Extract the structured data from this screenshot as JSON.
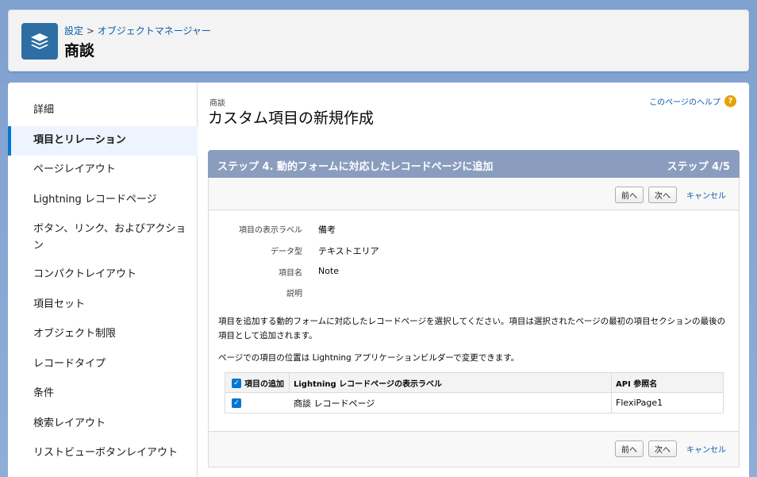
{
  "header": {
    "breadcrumb_setup": "設定",
    "breadcrumb_sep": ">",
    "breadcrumb_object_manager": "オブジェクトマネージャー",
    "title": "商談",
    "icon": "layers-icon"
  },
  "sidebar": {
    "items": [
      {
        "label": "詳細"
      },
      {
        "label": "項目とリレーション"
      },
      {
        "label": "ページレイアウト"
      },
      {
        "label": "Lightning レコードページ"
      },
      {
        "label": "ボタン、リンク、およびアクショ"
      },
      {
        "label": "ン"
      },
      {
        "label": "コンパクトレイアウト"
      },
      {
        "label": "項目セット"
      },
      {
        "label": "オブジェクト制限"
      },
      {
        "label": "レコードタイプ"
      },
      {
        "label": "条件"
      },
      {
        "label": "検索レイアウト"
      },
      {
        "label": "リストビューボタンレイアウト"
      }
    ]
  },
  "content": {
    "sup": "商談",
    "title": "カスタム項目の新規作成",
    "help_label": "このページのヘルプ",
    "help_glyph": "?",
    "step_title": "ステップ 4. 動的フォームに対応したレコードページに追加",
    "step_count": "ステップ 4/5",
    "buttons": {
      "prev": "前へ",
      "next": "次へ",
      "cancel": "キャンセル"
    },
    "fields": [
      {
        "label": "項目の表示ラベル",
        "value": "備考"
      },
      {
        "label": "データ型",
        "value": "テキストエリア"
      },
      {
        "label": "項目名",
        "value": "Note"
      },
      {
        "label": "説明",
        "value": ""
      }
    ],
    "desc1": "項目を追加する動的フォームに対応したレコードページを選択してください。項目は選択されたページの最初の項目セクションの最後の項目として追加されます。",
    "desc2": "ページでの項目の位置は Lightning アプリケーションビルダーで変更できます。",
    "table": {
      "headers": {
        "add": "項目の追加",
        "label": "Lightning レコードページの表示ラベル",
        "api": "API 参照名"
      },
      "rows": [
        {
          "checked": true,
          "label": "商談 レコードページ",
          "api": "FlexiPage1"
        }
      ]
    },
    "check_glyph": "✓"
  }
}
